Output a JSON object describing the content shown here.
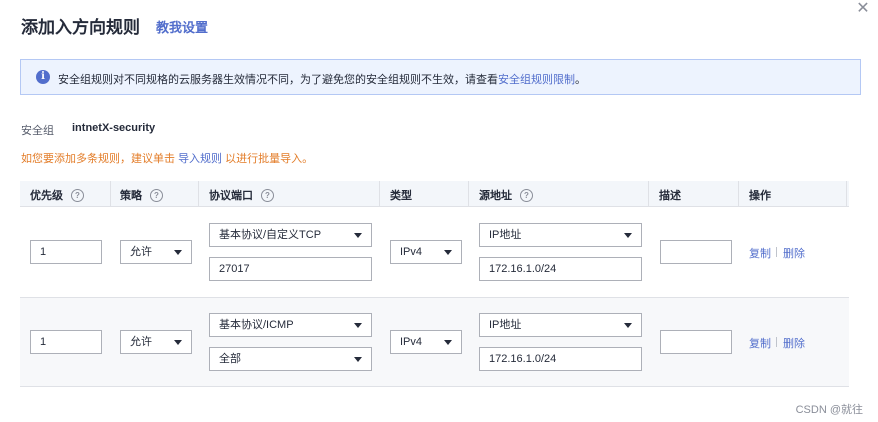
{
  "dialog": {
    "title": "添加入方向规则",
    "tutorial_link": "教我设置",
    "close_icon": "close-icon"
  },
  "info": {
    "text": "安全组规则对不同规格的云服务器生效情况不同，为了避免您的安全组规则不生效，请查看",
    "link": "安全组规则限制",
    "suffix": "。",
    "icon": "info-icon"
  },
  "security_group": {
    "label": "安全组",
    "value": "intnetX-security"
  },
  "hint": {
    "prefix": "如您要添加多条规则，建议单击",
    "link": "导入规则",
    "suffix": "以进行批量导入。"
  },
  "table": {
    "columns": {
      "priority": "优先级",
      "policy": "策略",
      "protocol_port": "协议端口",
      "type": "类型",
      "source": "源地址",
      "description": "描述",
      "actions": "操作"
    },
    "rows": [
      {
        "priority": "1",
        "policy": "允许",
        "protocol": "基本协议/自定义TCP",
        "port": "27017",
        "type": "IPv4",
        "source_type": "IP地址",
        "source_ip": "172.16.1.0/24",
        "description": "",
        "copy": "复制",
        "delete": "删除"
      },
      {
        "priority": "1",
        "policy": "允许",
        "protocol": "基本协议/ICMP",
        "port": "全部",
        "type": "IPv4",
        "source_type": "IP地址",
        "source_ip": "172.16.1.0/24",
        "description": "",
        "copy": "复制",
        "delete": "删除"
      }
    ]
  },
  "watermark": "CSDN @就往",
  "colors": {
    "link": "#526ecc",
    "warning": "#e37d29",
    "info_bg": "#edf3fe",
    "header_bg": "#f3f6fa"
  }
}
